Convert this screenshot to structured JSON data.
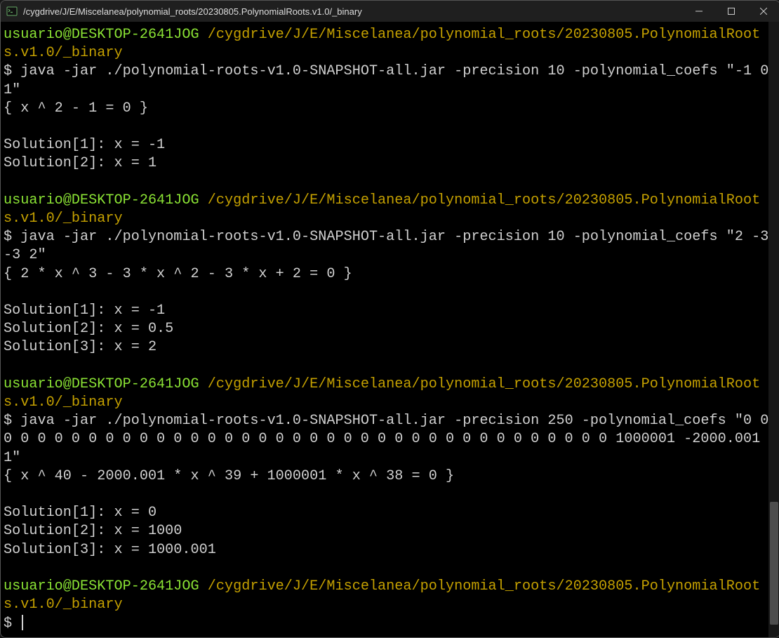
{
  "titlebar": {
    "title": "/cygdrive/J/E/Miscelanea/polynomial_roots/20230805.PolynomialRoots.v1.0/_binary"
  },
  "prompt": {
    "user_host": "usuario@DESKTOP-2641JOG",
    "path": "/cygdrive/J/E/Miscelanea/polynomial_roots/20230805.PolynomialRoots.v1.0/_binary",
    "symbol": "$"
  },
  "blocks": [
    {
      "command": "java -jar ./polynomial-roots-v1.0-SNAPSHOT-all.jar -precision 10 -polynomial_coefs \"-1 0 1\"",
      "output": "{ x ^ 2 - 1 = 0 }\n\nSolution[1]: x = -1\nSolution[2]: x = 1\n"
    },
    {
      "command": "java -jar ./polynomial-roots-v1.0-SNAPSHOT-all.jar -precision 10 -polynomial_coefs \"2 -3 -3 2\"",
      "output": "{ 2 * x ^ 3 - 3 * x ^ 2 - 3 * x + 2 = 0 }\n\nSolution[1]: x = -1\nSolution[2]: x = 0.5\nSolution[3]: x = 2\n"
    },
    {
      "command": "java -jar ./polynomial-roots-v1.0-SNAPSHOT-all.jar -precision 250 -polynomial_coefs \"0 0 0 0 0 0 0 0 0 0 0 0 0 0 0 0 0 0 0 0 0 0 0 0 0 0 0 0 0 0 0 0 0 0 0 0 0 0 1000001 -2000.001 1\"",
      "output": "{ x ^ 40 - 2000.001 * x ^ 39 + 1000001 * x ^ 38 = 0 }\n\nSolution[1]: x = 0\nSolution[2]: x = 1000\nSolution[3]: x = 1000.001\n"
    }
  ]
}
